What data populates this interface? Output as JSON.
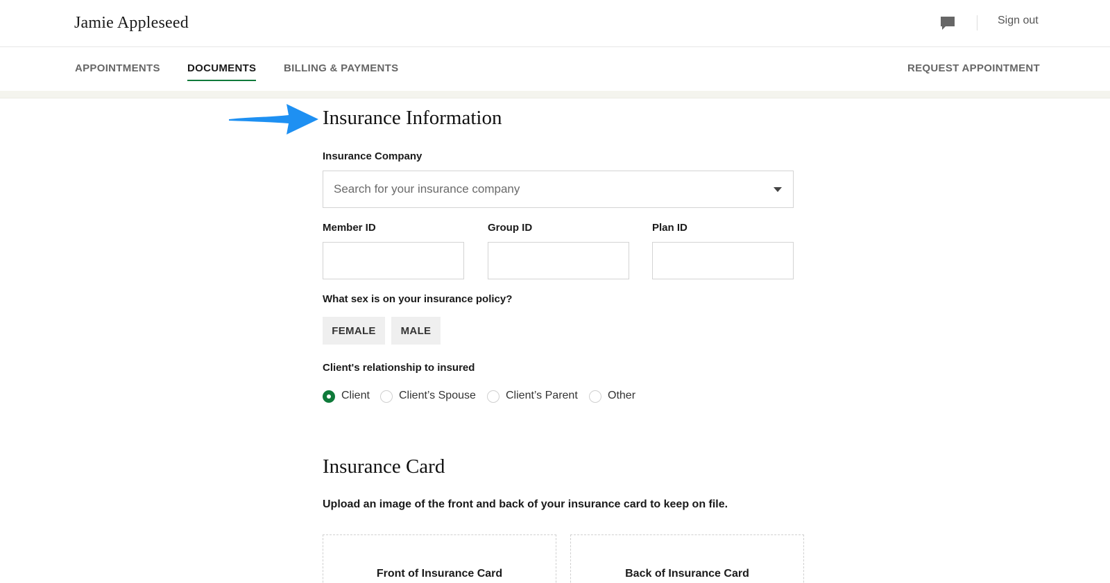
{
  "header": {
    "user_name": "Jamie Appleseed",
    "chat_icon": "chat-bubble-icon",
    "sign_out_label": "Sign out"
  },
  "nav": {
    "tabs": [
      {
        "label": "APPOINTMENTS",
        "active": false
      },
      {
        "label": "DOCUMENTS",
        "active": true
      },
      {
        "label": "BILLING & PAYMENTS",
        "active": false
      }
    ],
    "request_label": "REQUEST APPOINTMENT"
  },
  "annotation": {
    "icon": "arrow-right-icon",
    "color": "#1e90f2"
  },
  "insurance_info": {
    "title": "Insurance Information",
    "company_label": "Insurance Company",
    "company_placeholder": "Search for your insurance company",
    "member_id_label": "Member ID",
    "member_id_value": "",
    "group_id_label": "Group ID",
    "group_id_value": "",
    "plan_id_label": "Plan ID",
    "plan_id_value": "",
    "sex_question": "What sex is on your insurance policy?",
    "sex_options": [
      "FEMALE",
      "MALE"
    ],
    "relationship_label": "Client's relationship to insured",
    "relationship_options": [
      "Client",
      "Client’s Spouse",
      "Client’s Parent",
      "Other"
    ],
    "relationship_selected": "Client"
  },
  "insurance_card": {
    "title": "Insurance Card",
    "description": "Upload an image of the front and back of your insurance card to keep on file.",
    "front_label": "Front of Insurance Card",
    "back_label": "Back of Insurance Card"
  },
  "colors": {
    "accent_green": "#0f7a3a",
    "arrow_blue": "#1e90f2"
  }
}
